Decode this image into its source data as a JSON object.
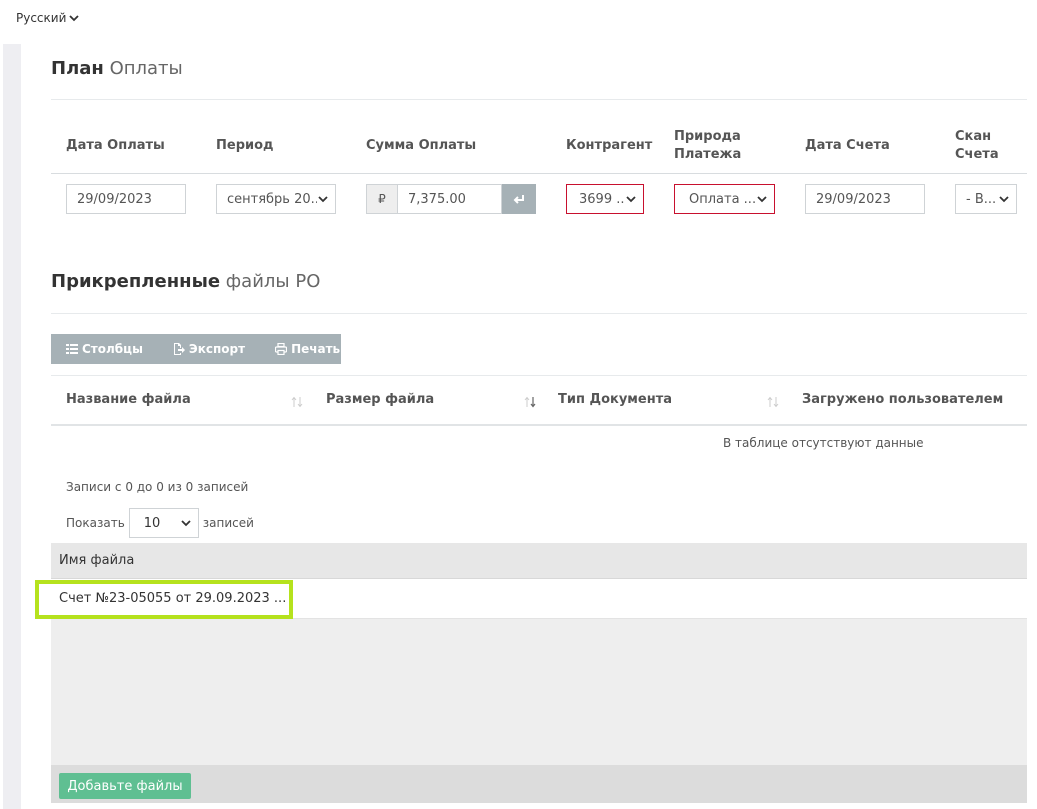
{
  "language": {
    "label": "Русский"
  },
  "payment_plan": {
    "title_bold": "План",
    "title_light": "Оплаты",
    "headers": {
      "date": "Дата Оплаты",
      "period": "Период",
      "amount": "Сумма Оплаты",
      "counterparty": "Контрагент",
      "nature_line1": "Природа",
      "nature_line2": "Платежа",
      "invoice_date": "Дата Счета",
      "scan_line1": "Скан",
      "scan_line2": "Счета"
    },
    "row": {
      "date": "29/09/2023",
      "period": "сентябрь 20...",
      "currency_symbol": "₽",
      "amount": "7,375.00",
      "counterparty": "3699 ...",
      "nature": "Оплата ...",
      "invoice_date": "29/09/2023",
      "scan": "- В..."
    },
    "colors": {
      "error_border": "#c8102e",
      "button_gray": "#a6b1b6"
    }
  },
  "attachments": {
    "title_bold": "Прикрепленные",
    "title_light": "файлы PO",
    "toolbar": {
      "columns": "Столбцы",
      "export": "Экспорт",
      "print": "Печать"
    },
    "table_headers": {
      "file_name": "Название файла",
      "file_size": "Размер файла",
      "doc_type": "Тип Документа",
      "uploaded_by": "Загружено пользователем"
    },
    "empty_message": "В таблице отсутствуют данные",
    "info": "Записи с 0 до 0 из 0 записей",
    "show_label": "Показать",
    "page_size": "10",
    "records_label": "записей"
  },
  "files": {
    "header": "Имя файла",
    "items": [
      "Счет №23-05055 от 29.09.2023 ..."
    ],
    "add_button": "Добавьте файлы",
    "colors": {
      "add_button": "#5fbf92",
      "highlight": "#b5e21d"
    }
  }
}
